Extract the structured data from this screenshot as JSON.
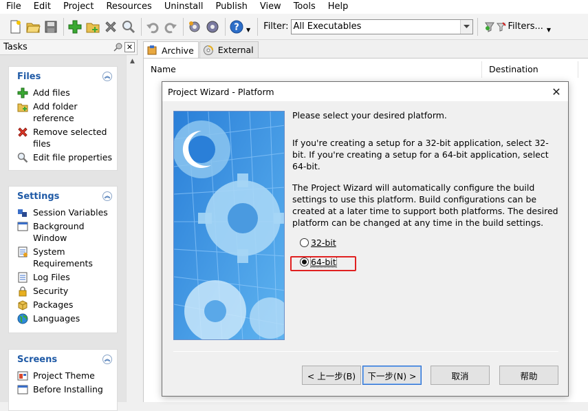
{
  "menu": [
    "File",
    "Edit",
    "Project",
    "Resources",
    "Uninstall",
    "Publish",
    "View",
    "Tools",
    "Help"
  ],
  "toolbar": {
    "filter_label": "Filter:",
    "filter_value": "All Executables",
    "filters_label": "Filters..."
  },
  "tasks_pane": {
    "title": "Tasks",
    "groups": [
      {
        "title": "Files",
        "items": [
          "Add files",
          "Add folder reference",
          "Remove selected files",
          "Edit file properties"
        ]
      },
      {
        "title": "Settings",
        "items": [
          "Session Variables",
          "Background Window",
          "System Requirements",
          "Log Files",
          "Security",
          "Packages",
          "Languages"
        ]
      },
      {
        "title": "Screens",
        "items": [
          "Project Theme",
          "Before Installing"
        ]
      }
    ]
  },
  "tabs": [
    "Archive",
    "External"
  ],
  "columns": [
    "Name",
    "Destination"
  ],
  "dialog": {
    "title": "Project Wizard - Platform",
    "prompt": "Please select your desired platform.",
    "para1": "If you're creating a setup for a 32-bit application, select 32-bit. If you're creating a setup for a 64-bit application, select 64-bit.",
    "para2": "The Project Wizard will automatically configure the build settings to use this platform. Build configurations can be created at a later time to support both platforms. The desired platform can be changed at any time in the build settings.",
    "options": [
      {
        "label": "32-bit",
        "selected": false
      },
      {
        "label": "64-bit",
        "selected": true
      }
    ],
    "buttons": {
      "back": "< 上一步(B)",
      "next": "下一步(N) >",
      "cancel": "取消",
      "help": "帮助"
    }
  },
  "colors": {
    "accent": "#1f5aa6",
    "highlight_box": "#e02020"
  }
}
